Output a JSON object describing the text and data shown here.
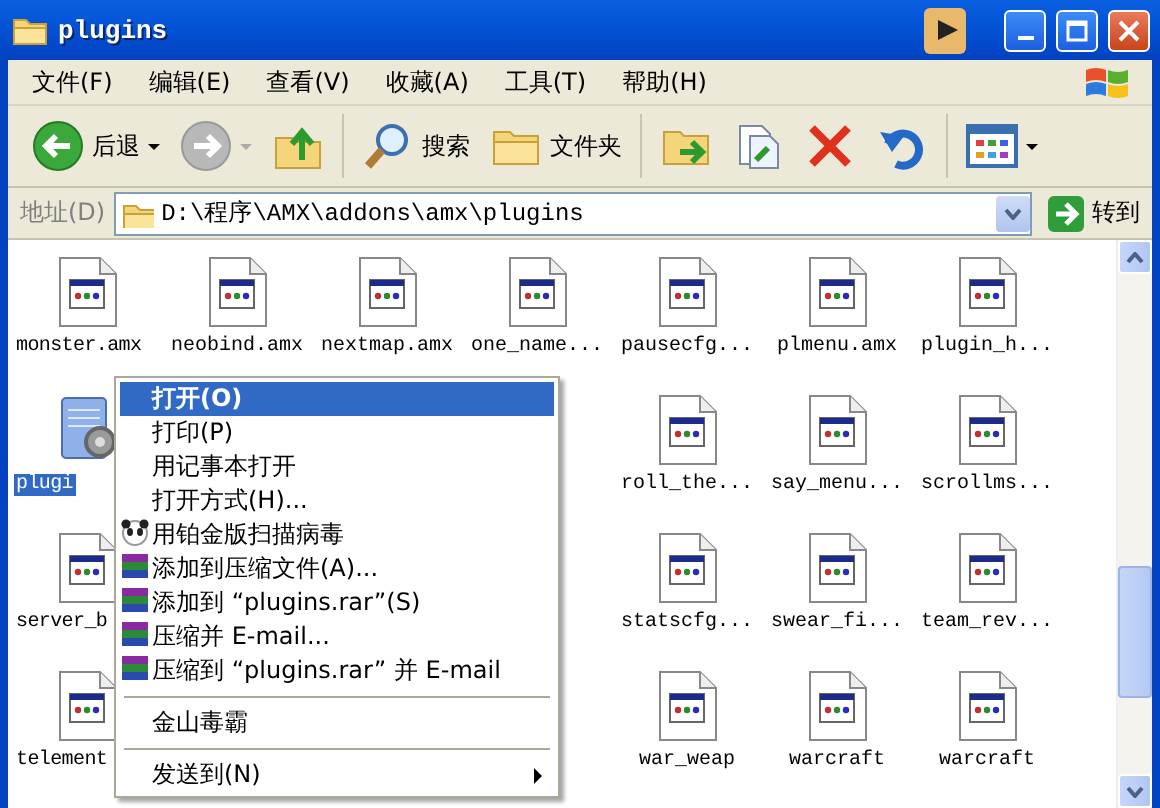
{
  "window": {
    "title": "plugins"
  },
  "menu_bar": [
    {
      "label": "文件(F)"
    },
    {
      "label": "编辑(E)"
    },
    {
      "label": "查看(V)"
    },
    {
      "label": "收藏(A)"
    },
    {
      "label": "工具(T)"
    },
    {
      "label": "帮助(H)"
    }
  ],
  "toolbar": [
    {
      "kind": "back",
      "label": "后退",
      "disabled": false
    },
    {
      "kind": "forward",
      "disabled": true
    },
    {
      "kind": "up"
    },
    {
      "kind": "search",
      "label": "搜索"
    },
    {
      "kind": "folders",
      "label": "文件夹"
    },
    {
      "kind": "move"
    },
    {
      "kind": "copy"
    },
    {
      "kind": "delete"
    },
    {
      "kind": "undo"
    },
    {
      "kind": "views"
    }
  ],
  "address_bar": {
    "label": "地址(D)",
    "value": "D:\\程序\\AMX\\addons\\amx\\plugins",
    "go_label": "转到"
  },
  "file_rows": [
    [
      {
        "label": "monster.amx",
        "kind": "amx",
        "selected": false
      },
      {
        "label": "neobind.amx",
        "kind": "amx",
        "selected": false
      },
      {
        "label": "nextmap.amx",
        "kind": "amx",
        "selected": false
      },
      {
        "label": "one_name...",
        "kind": "amx",
        "selected": false
      },
      {
        "label": "pausecfg...",
        "kind": "amx",
        "selected": false
      },
      {
        "label": "plmenu.amx",
        "kind": "amx",
        "selected": false
      },
      {
        "label": "plugin_h...",
        "kind": "amx",
        "selected": false
      }
    ],
    [
      {
        "label": "plugi",
        "kind": "config",
        "selected": true
      },
      null,
      null,
      null,
      {
        "label": "roll_the...",
        "kind": "amx",
        "selected": false
      },
      {
        "label": "say_menu...",
        "kind": "amx",
        "selected": false
      },
      {
        "label": "scrollms...",
        "kind": "amx",
        "selected": false
      }
    ],
    [
      {
        "label": "server_b",
        "kind": "amx",
        "selected": false
      },
      null,
      null,
      null,
      {
        "label": "statscfg...",
        "kind": "amx",
        "selected": false
      },
      {
        "label": "swear_fi...",
        "kind": "amx",
        "selected": false
      },
      {
        "label": "team_rev...",
        "kind": "amx",
        "selected": false
      }
    ],
    [
      {
        "label": "telement",
        "kind": "amx",
        "selected": false
      },
      null,
      null,
      null,
      {
        "label": "war_weap",
        "kind": "amx",
        "selected": false
      },
      {
        "label": "warcraft",
        "kind": "amx",
        "selected": false
      },
      {
        "label": "warcraft",
        "kind": "amx",
        "selected": false
      }
    ]
  ],
  "context_menu": [
    {
      "kind": "item",
      "label": "打开(O)",
      "selected": true,
      "default": true
    },
    {
      "kind": "item",
      "label": "打印(P)",
      "selected": false,
      "default": false
    },
    {
      "kind": "item",
      "label": "用记事本打开",
      "selected": false,
      "default": false
    },
    {
      "kind": "item",
      "label": "打开方式(H)...",
      "selected": false,
      "default": false
    },
    {
      "kind": "panda",
      "label": "用铂金版扫描病毒",
      "selected": false,
      "default": false
    },
    {
      "kind": "archive",
      "label": "添加到压缩文件(A)...",
      "selected": false,
      "default": false
    },
    {
      "kind": "archive",
      "label": "添加到 “plugins.rar”(S)",
      "selected": false,
      "default": false
    },
    {
      "kind": "archive",
      "label": "压缩并 E-mail...",
      "selected": false,
      "default": false
    },
    {
      "kind": "archive",
      "label": "压缩到 “plugins.rar” 并 E-mail",
      "selected": false,
      "default": false
    },
    {
      "kind": "separator"
    },
    {
      "kind": "item",
      "label": "金山毒霸",
      "selected": false,
      "default": false
    },
    {
      "kind": "separator"
    },
    {
      "kind": "submenu",
      "label": "发送到(N)",
      "selected": false,
      "default": false
    }
  ]
}
